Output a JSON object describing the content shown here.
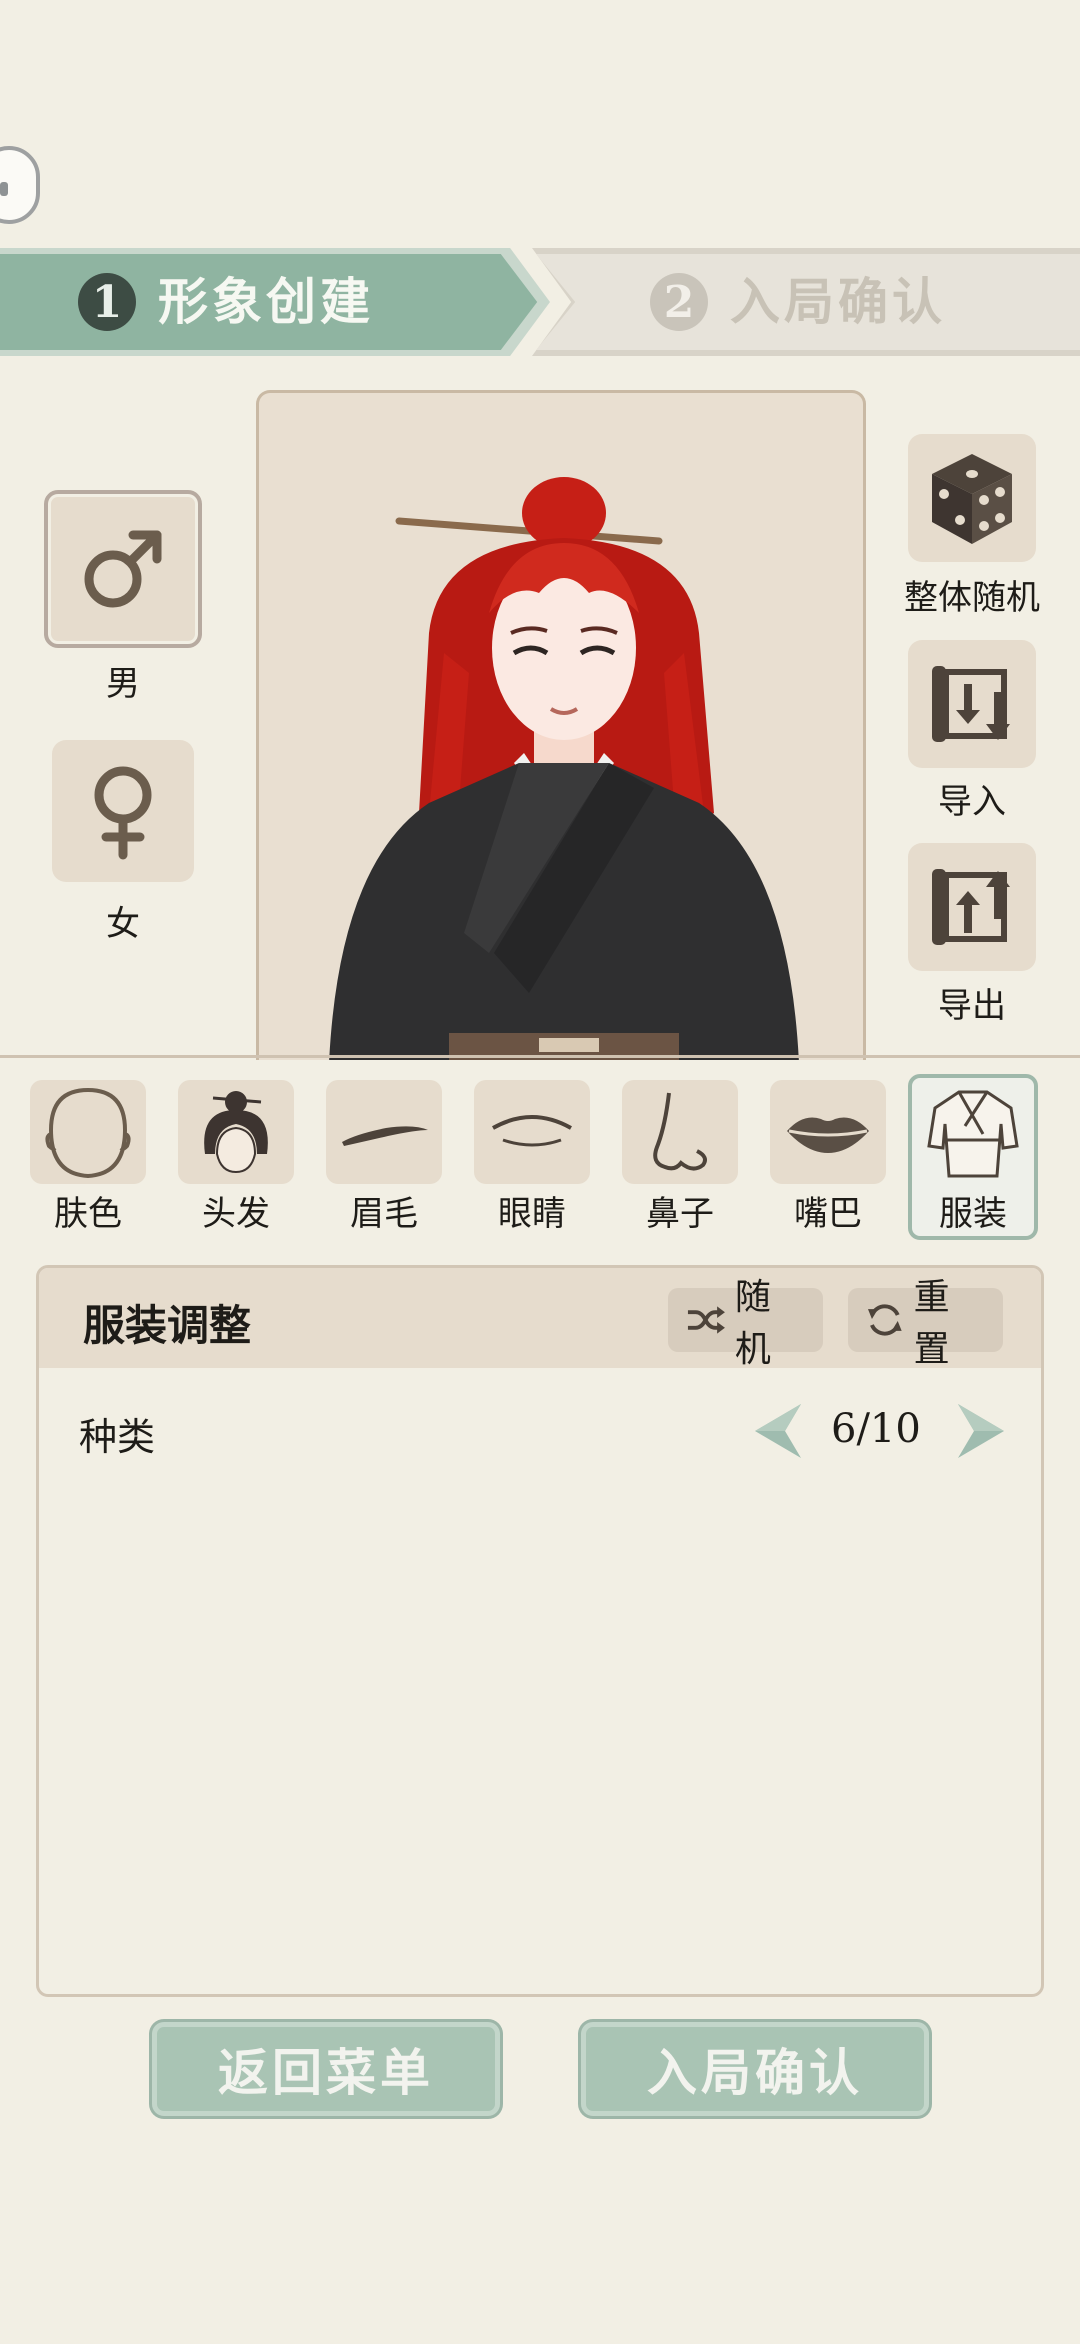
{
  "steps": [
    {
      "num": "1",
      "label": "形象创建",
      "active": true
    },
    {
      "num": "2",
      "label": "入局确认",
      "active": false
    }
  ],
  "gender": {
    "male": {
      "label": "男",
      "icon": "male-symbol-icon",
      "selected": true
    },
    "female": {
      "label": "女",
      "icon": "female-symbol-icon",
      "selected": false
    }
  },
  "right_actions": [
    {
      "label": "整体随机",
      "icon": "dice-icon"
    },
    {
      "label": "导入",
      "icon": "import-scroll-icon"
    },
    {
      "label": "导出",
      "icon": "export-scroll-icon"
    }
  ],
  "categories": [
    {
      "label": "肤色",
      "icon": "face-outline-icon"
    },
    {
      "label": "头发",
      "icon": "hair-icon"
    },
    {
      "label": "眉毛",
      "icon": "eyebrow-icon"
    },
    {
      "label": "眼睛",
      "icon": "eye-icon"
    },
    {
      "label": "鼻子",
      "icon": "nose-icon"
    },
    {
      "label": "嘴巴",
      "icon": "lips-icon"
    },
    {
      "label": "服装",
      "icon": "robe-icon",
      "selected": true
    }
  ],
  "panel": {
    "title": "服装调整",
    "random_label": "随机",
    "reset_label": "重置",
    "row_label": "种类",
    "current": "6/10"
  },
  "buttons": {
    "back": "返回菜单",
    "confirm": "入局确认"
  },
  "colors": {
    "background": "#f2efe4",
    "accent": "#8fb4a1",
    "tile": "#e6dccd",
    "icon": "#6b5d4d",
    "hair": "#c61f16",
    "robe": "#2f2f30"
  }
}
